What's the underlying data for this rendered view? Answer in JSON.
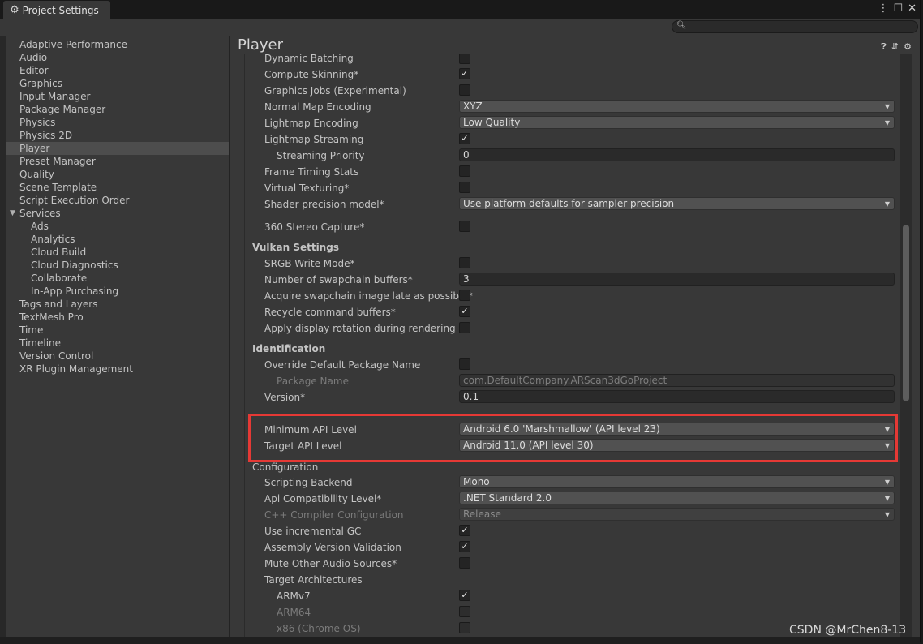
{
  "window": {
    "title": "Project Settings"
  },
  "search": {
    "placeholder": ""
  },
  "sidebar": {
    "items": [
      {
        "label": "Adaptive Performance",
        "indent": false
      },
      {
        "label": "Audio",
        "indent": false
      },
      {
        "label": "Editor",
        "indent": false
      },
      {
        "label": "Graphics",
        "indent": false
      },
      {
        "label": "Input Manager",
        "indent": false
      },
      {
        "label": "Package Manager",
        "indent": false
      },
      {
        "label": "Physics",
        "indent": false
      },
      {
        "label": "Physics 2D",
        "indent": false
      },
      {
        "label": "Player",
        "indent": false,
        "selected": true
      },
      {
        "label": "Preset Manager",
        "indent": false
      },
      {
        "label": "Quality",
        "indent": false
      },
      {
        "label": "Scene Template",
        "indent": false
      },
      {
        "label": "Script Execution Order",
        "indent": false
      },
      {
        "label": "Services",
        "indent": false,
        "expanded": true
      },
      {
        "label": "Ads",
        "indent": true
      },
      {
        "label": "Analytics",
        "indent": true
      },
      {
        "label": "Cloud Build",
        "indent": true
      },
      {
        "label": "Cloud Diagnostics",
        "indent": true
      },
      {
        "label": "Collaborate",
        "indent": true
      },
      {
        "label": "In-App Purchasing",
        "indent": true
      },
      {
        "label": "Tags and Layers",
        "indent": false
      },
      {
        "label": "TextMesh Pro",
        "indent": false
      },
      {
        "label": "Time",
        "indent": false
      },
      {
        "label": "Timeline",
        "indent": false
      },
      {
        "label": "Version Control",
        "indent": false
      },
      {
        "label": "XR Plugin Management",
        "indent": false
      }
    ]
  },
  "main": {
    "title": "Player"
  },
  "settings": {
    "dynamic_batching": {
      "label": "Dynamic Batching",
      "checked": false
    },
    "compute_skinning": {
      "label": "Compute Skinning*",
      "checked": true
    },
    "graphics_jobs": {
      "label": "Graphics Jobs (Experimental)",
      "checked": false
    },
    "normal_map_encoding": {
      "label": "Normal Map Encoding",
      "value": "XYZ"
    },
    "lightmap_encoding": {
      "label": "Lightmap Encoding",
      "value": "Low Quality"
    },
    "lightmap_streaming": {
      "label": "Lightmap Streaming",
      "checked": true
    },
    "streaming_priority": {
      "label": "Streaming Priority",
      "value": "0"
    },
    "frame_timing_stats": {
      "label": "Frame Timing Stats",
      "checked": false
    },
    "virtual_texturing": {
      "label": "Virtual Texturing*",
      "checked": false
    },
    "shader_precision": {
      "label": "Shader precision model*",
      "value": "Use platform defaults for sampler precision"
    },
    "stereo_capture": {
      "label": "360 Stereo Capture*",
      "checked": false
    },
    "vulkan_header": "Vulkan Settings",
    "srgb_write": {
      "label": "SRGB Write Mode*",
      "checked": false
    },
    "swapchain_buffers": {
      "label": "Number of swapchain buffers*",
      "value": "3"
    },
    "acquire_late": {
      "label": "Acquire swapchain image late as possible*",
      "checked": false
    },
    "recycle_buffers": {
      "label": "Recycle command buffers*",
      "checked": true
    },
    "display_rotation": {
      "label": "Apply display rotation during rendering",
      "checked": false
    },
    "identification_header": "Identification",
    "override_package": {
      "label": "Override Default Package Name",
      "checked": false
    },
    "package_name": {
      "label": "Package Name",
      "value": "com.DefaultCompany.ARScan3dGoProject"
    },
    "version": {
      "label": "Version*",
      "value": "0.1"
    },
    "min_api": {
      "label": "Minimum API Level",
      "value": "Android 6.0 'Marshmallow' (API level 23)"
    },
    "target_api": {
      "label": "Target API Level",
      "value": "Android 11.0 (API level 30)"
    },
    "configuration_header": "Configuration",
    "scripting_backend": {
      "label": "Scripting Backend",
      "value": "Mono"
    },
    "api_compat": {
      "label": "Api Compatibility Level*",
      "value": ".NET Standard 2.0"
    },
    "cpp_config": {
      "label": "C++ Compiler Configuration",
      "value": "Release"
    },
    "incremental_gc": {
      "label": "Use incremental GC",
      "checked": true
    },
    "assembly_validation": {
      "label": "Assembly Version Validation",
      "checked": true
    },
    "mute_audio": {
      "label": "Mute Other Audio Sources*",
      "checked": false
    },
    "target_arch_label": "Target Architectures",
    "armv7": {
      "label": "ARMv7",
      "checked": true
    },
    "arm64": {
      "label": "ARM64",
      "checked": false
    },
    "x86": {
      "label": "x86 (Chrome OS)",
      "checked": false
    }
  },
  "highlight_color": "#e53935",
  "watermark": "CSDN @MrChen8-13"
}
